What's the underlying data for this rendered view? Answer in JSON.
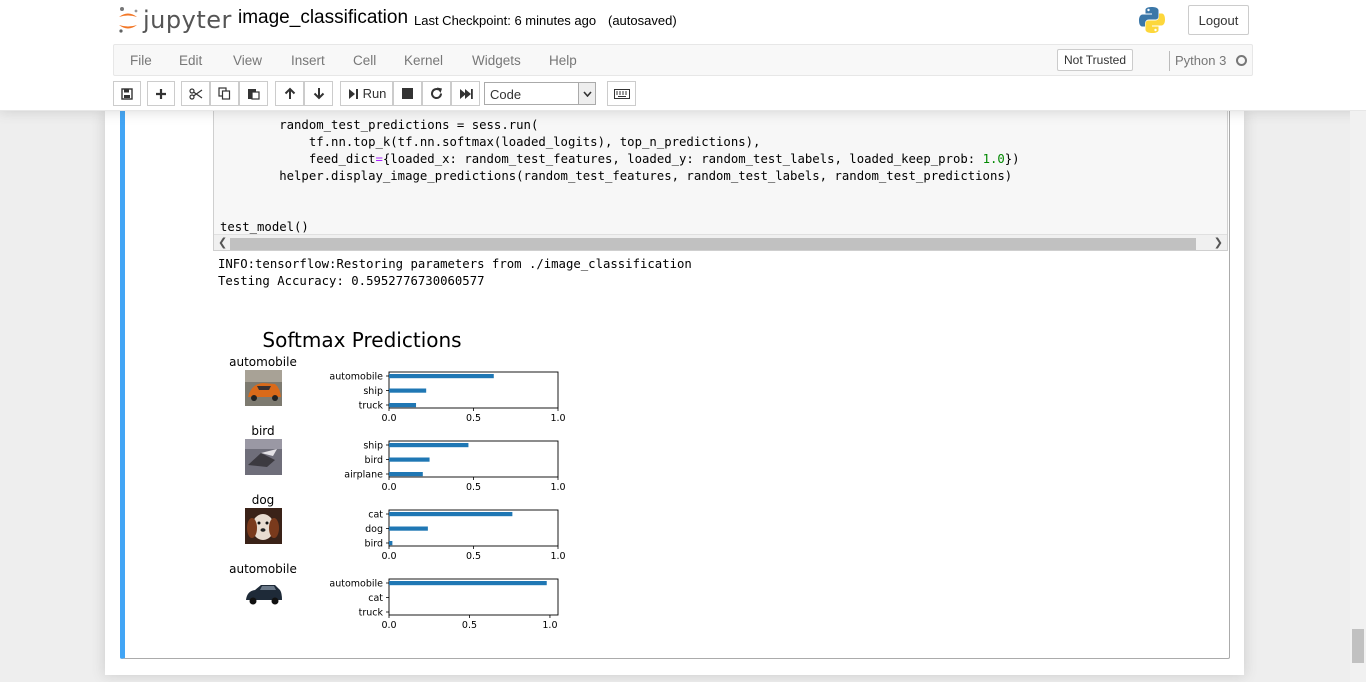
{
  "header": {
    "logo_text": "jupyter",
    "notebook_name": "image_classification",
    "checkpoint": "Last Checkpoint: 6 minutes ago",
    "autosave": "(autosaved)",
    "logout": "Logout"
  },
  "menu": {
    "items": [
      "File",
      "Edit",
      "View",
      "Insert",
      "Cell",
      "Kernel",
      "Widgets",
      "Help"
    ],
    "trust": "Not Trusted",
    "kernel": "Python 3"
  },
  "toolbar": {
    "run_label": "Run",
    "cell_type": "Code",
    "icons": [
      "save-icon",
      "plus-icon",
      "scissors-icon",
      "copy-icon",
      "paste-icon",
      "arrow-up-icon",
      "arrow-down-icon",
      "run-icon",
      "stop-icon",
      "restart-icon",
      "fast-forward-icon",
      "keyboard-icon"
    ]
  },
  "code": {
    "lines": [
      "        random_test_predictions = sess.run(",
      "            tf.nn.top_k(tf.nn.softmax(loaded_logits), top_n_predictions),",
      "            feed_dict={loaded_x: random_test_features, loaded_y: random_test_labels, loaded_keep_prob: 1.0})",
      "        helper.display_image_predictions(random_test_features, random_test_labels, random_test_predictions)",
      "",
      "",
      "test_model()"
    ]
  },
  "output": {
    "lines": [
      "INFO:tensorflow:Restoring parameters from ./image_classification",
      "Testing Accuracy: 0.5952776730060577"
    ]
  },
  "chart_data": {
    "type": "bar",
    "title": "Softmax Predictions",
    "orientation": "horizontal",
    "bar_color": "#1f77b4",
    "subplots": [
      {
        "image_label": "automobile",
        "categories": [
          "automobile",
          "ship",
          "truck"
        ],
        "values": [
          0.62,
          0.22,
          0.16
        ],
        "xlim": [
          0,
          1.0
        ],
        "xticks": [
          "0.0",
          "0.5",
          "1.0"
        ]
      },
      {
        "image_label": "bird",
        "categories": [
          "ship",
          "bird",
          "airplane"
        ],
        "values": [
          0.47,
          0.24,
          0.2
        ],
        "xlim": [
          0,
          1.0
        ],
        "xticks": [
          "0.0",
          "0.5",
          "1.0"
        ]
      },
      {
        "image_label": "dog",
        "categories": [
          "cat",
          "dog",
          "bird"
        ],
        "values": [
          0.73,
          0.23,
          0.02
        ],
        "xlim": [
          0,
          1.0
        ],
        "xticks": [
          "0.0",
          "0.5",
          "1.0"
        ]
      },
      {
        "image_label": "automobile",
        "categories": [
          "automobile",
          "cat",
          "truck"
        ],
        "values": [
          0.98,
          0.0,
          0.0
        ],
        "xlim": [
          0,
          1.05
        ],
        "xticks": [
          "0.0",
          "0.5",
          "1.0"
        ]
      }
    ]
  }
}
